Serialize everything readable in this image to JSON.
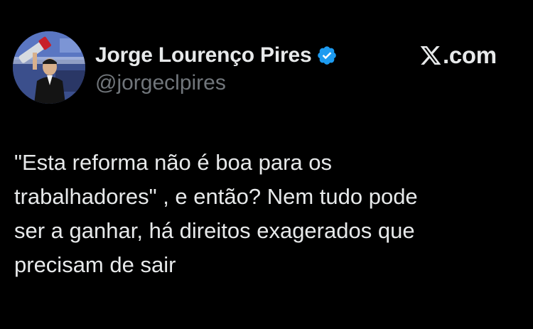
{
  "tweet": {
    "author": {
      "display_name": "Jorge Lourenço Pires",
      "handle": "@jorgeclpires",
      "verified": true,
      "badge_color": "#1d9bf0"
    },
    "site": {
      "label": ".com",
      "icon": "x-logo-icon"
    },
    "text_lines": [
      "\"Esta reforma não é boa para os",
      "trabalhadores\" , e então? Nem tudo pode",
      "ser a ganhar, há direitos exagerados que",
      "precisam de sair"
    ]
  },
  "colors": {
    "background": "#000000",
    "primary_text": "#e7e9ea",
    "secondary_text": "#71767b"
  }
}
